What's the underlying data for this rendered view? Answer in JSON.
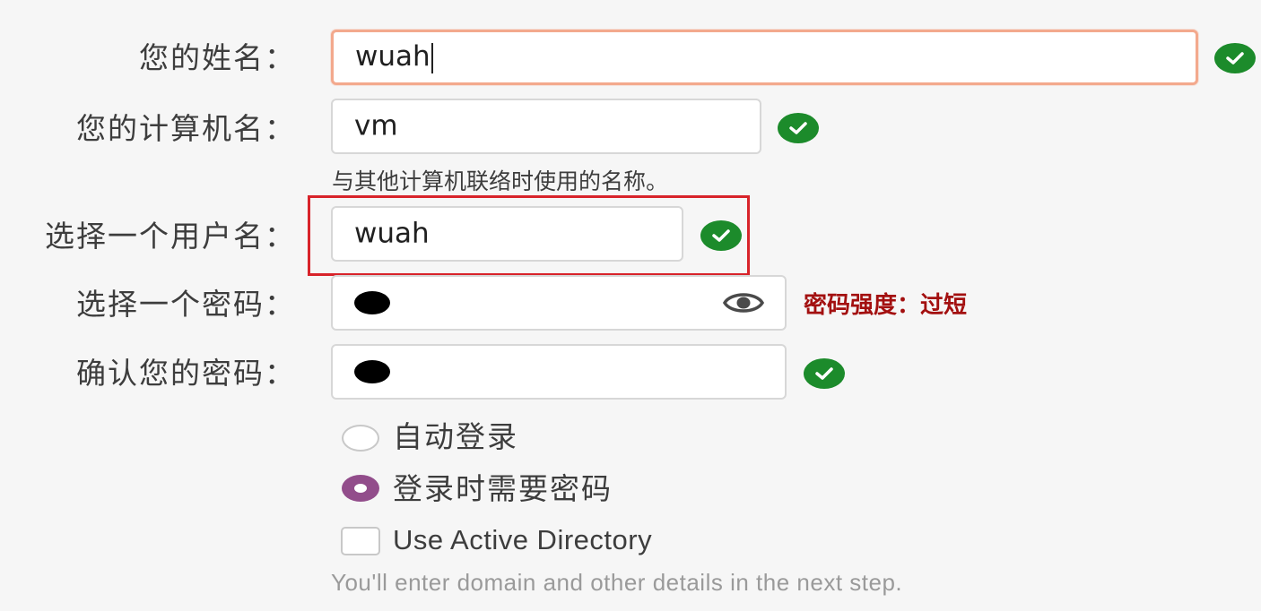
{
  "form": {
    "full_name": {
      "label": "您的姓名：",
      "value": "wuah"
    },
    "computer_name": {
      "label": "您的计算机名：",
      "value": "vm",
      "hint": "与其他计算机联络时使用的名称。"
    },
    "username": {
      "label": "选择一个用户名：",
      "value": "wuah"
    },
    "password": {
      "label": "选择一个密码：",
      "strength": "密码强度：过短"
    },
    "confirm_password": {
      "label": "确认您的密码："
    },
    "login": {
      "auto_login_label": "自动登录",
      "require_password_label": "登录时需要密码",
      "selected": "require_password"
    },
    "active_directory": {
      "label": "Use Active Directory",
      "hint": "You'll enter domain and other details in the next step.",
      "checked": false
    }
  },
  "colors": {
    "valid_check": "#1c8b2b",
    "focus_border": "#f3a98d",
    "strength_text": "#a31010",
    "radio_accent": "#924d8b",
    "highlight_box": "#d8232a"
  },
  "icons": {
    "valid": "check-circle-icon",
    "reveal_password": "eye-icon"
  }
}
